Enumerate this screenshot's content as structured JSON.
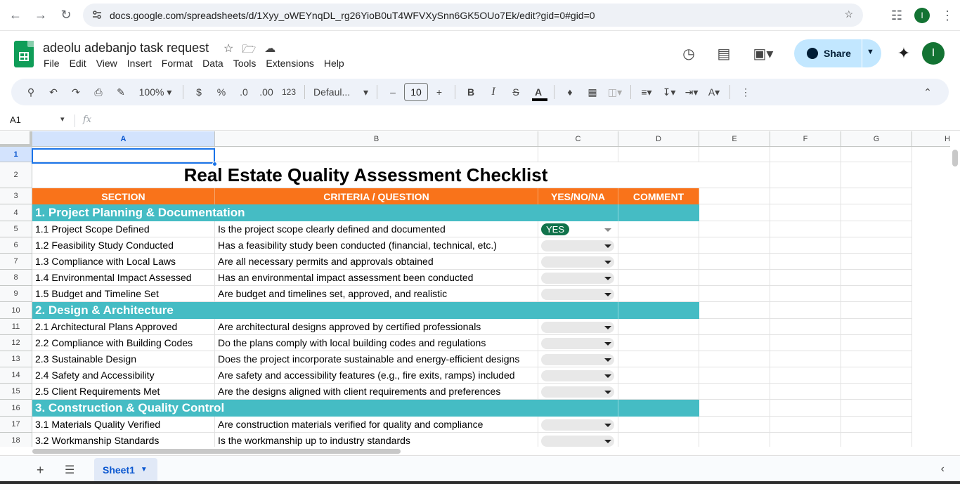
{
  "browser": {
    "url": "docs.google.com/spreadsheets/d/1Xyy_oWEYnqDL_rg26YioB0uT4WFVXySnn6GK5OUo7Ek/edit?gid=0#gid=0",
    "profile_initial": "I"
  },
  "doc": {
    "title": "adeolu adebanjo task request",
    "menu": [
      "File",
      "Edit",
      "View",
      "Insert",
      "Format",
      "Data",
      "Tools",
      "Extensions",
      "Help"
    ],
    "share_label": "Share",
    "account_initial": "I"
  },
  "toolbar": {
    "zoom": "100%",
    "currency": "$",
    "percent": "%",
    "dec_decrease": ".0",
    "dec_increase": ".00",
    "number_format": "123",
    "font": "Defaul...",
    "font_size": "10",
    "bold": "B",
    "italic": "I",
    "strike": "S",
    "text_color": "A"
  },
  "formula_bar": {
    "name_box": "A1",
    "fx": "fx"
  },
  "columns": [
    "A",
    "B",
    "C",
    "D",
    "E",
    "F",
    "G",
    "H"
  ],
  "rows": [
    "1",
    "2",
    "3",
    "4",
    "5",
    "6",
    "7",
    "8",
    "9",
    "10",
    "11",
    "12",
    "13",
    "14",
    "15",
    "16",
    "17",
    "18"
  ],
  "sheet": {
    "title": "Real Estate Quality Assessment Checklist",
    "headers": [
      "SECTION",
      "CRITERIA / QUESTION",
      "YES/NO/NA",
      "COMMENT"
    ],
    "sections": [
      "1. Project Planning & Documentation",
      "2. Design & Architecture",
      "3. Construction & Quality Control"
    ],
    "items": [
      {
        "section": "1.1 Project Scope Defined",
        "question": "Is the project scope clearly defined and documented",
        "answer": "YES"
      },
      {
        "section": "1.2 Feasibility Study Conducted",
        "question": "Has a feasibility study been conducted (financial, technical, etc.)",
        "answer": ""
      },
      {
        "section": "1.3 Compliance with Local Laws",
        "question": "Are all necessary permits and approvals obtained",
        "answer": ""
      },
      {
        "section": "1.4 Environmental Impact Assessed",
        "question": "Has an environmental impact assessment been conducted",
        "answer": ""
      },
      {
        "section": "1.5 Budget and Timeline Set",
        "question": "Are budget and timelines set, approved, and realistic",
        "answer": ""
      },
      {
        "section": "2.1 Architectural Plans Approved",
        "question": "Are architectural designs approved by certified professionals",
        "answer": ""
      },
      {
        "section": "2.2 Compliance with Building Codes",
        "question": "Do the plans comply with local building codes and regulations",
        "answer": ""
      },
      {
        "section": "2.3 Sustainable Design",
        "question": "Does the project incorporate sustainable and energy-efficient designs",
        "answer": ""
      },
      {
        "section": "2.4 Safety and Accessibility",
        "question": "Are safety and accessibility features (e.g., fire exits, ramps) included",
        "answer": ""
      },
      {
        "section": "2.5 Client Requirements Met",
        "question": "Are the designs aligned with client requirements and preferences",
        "answer": ""
      },
      {
        "section": "3.1 Materials Quality Verified",
        "question": "Are construction materials verified for quality and compliance",
        "answer": ""
      },
      {
        "section": "3.2 Workmanship Standards",
        "question": "Is the workmanship up to industry standards",
        "answer": ""
      }
    ]
  },
  "sheet_tabs": {
    "active": "Sheet1"
  },
  "colors": {
    "header_orange": "#f9731a",
    "section_teal": "#45bcc4",
    "yes_green": "#11734b",
    "selection_blue": "#1a73e8",
    "share_blue": "#c2e7ff"
  }
}
